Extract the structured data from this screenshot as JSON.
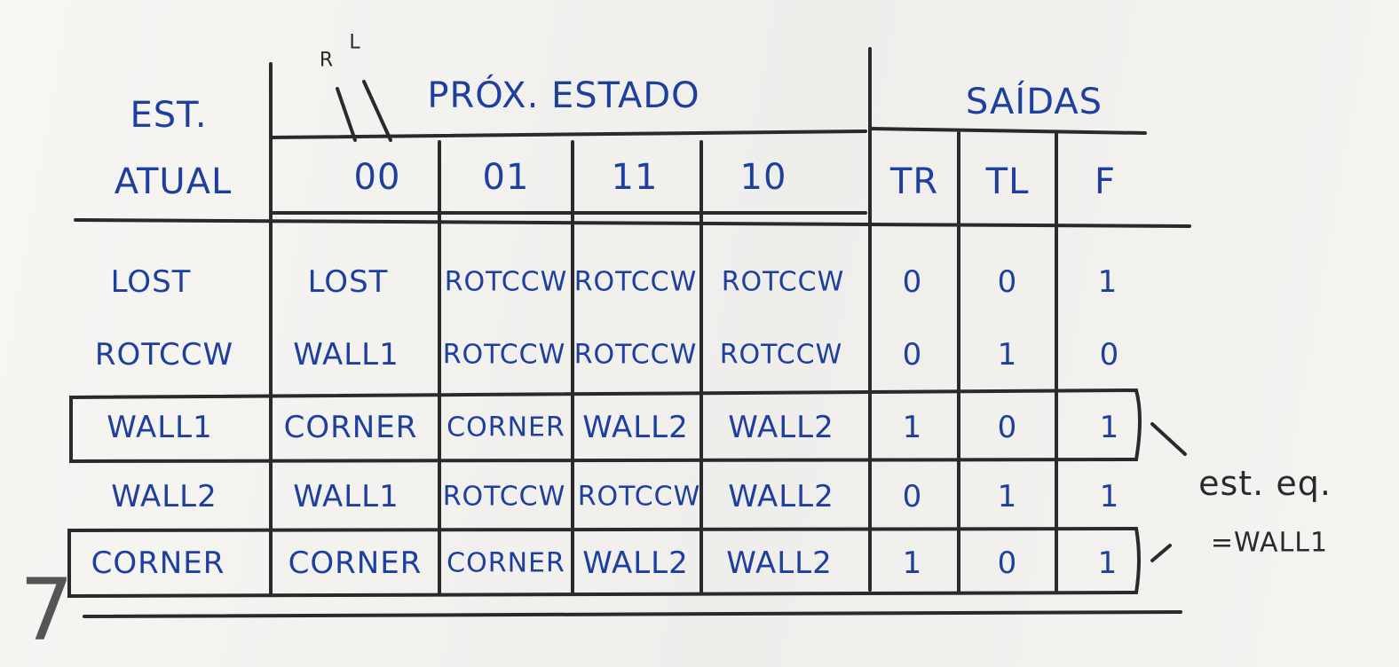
{
  "table": {
    "header": {
      "current_state_line1": "EST.",
      "current_state_line2": "ATUAL",
      "next_state": "PRÓX. ESTADO",
      "inputs_label_r": "R",
      "inputs_label_l": "L",
      "outputs": "SAÍDAS",
      "input_columns": [
        "00",
        "01",
        "11",
        "10"
      ],
      "output_columns": [
        "TR",
        "TL",
        "F"
      ]
    },
    "rows": [
      {
        "state": "LOST",
        "next": [
          "LOST",
          "ROTCCW",
          "ROTCCW",
          "ROTCCW"
        ],
        "outputs": [
          "0",
          "0",
          "1"
        ]
      },
      {
        "state": "ROTCCW",
        "next": [
          "WALL1",
          "ROTCCW",
          "ROTCCW",
          "ROTCCW"
        ],
        "outputs": [
          "0",
          "1",
          "0"
        ]
      },
      {
        "state": "WALL1",
        "next": [
          "CORNER",
          "CORNER",
          "WALL2",
          "WALL2"
        ],
        "outputs": [
          "1",
          "0",
          "1"
        ]
      },
      {
        "state": "WALL2",
        "next": [
          "WALL1",
          "ROTCCW",
          "ROTCCW",
          "WALL2"
        ],
        "outputs": [
          "0",
          "1",
          "1"
        ]
      },
      {
        "state": "CORNER",
        "next": [
          "CORNER",
          "CORNER",
          "WALL2",
          "WALL2"
        ],
        "outputs": [
          "1",
          "0",
          "1"
        ]
      }
    ]
  },
  "annotation": {
    "text": "est. eq.",
    "equals": "=WALL1"
  },
  "page_number": "7"
}
